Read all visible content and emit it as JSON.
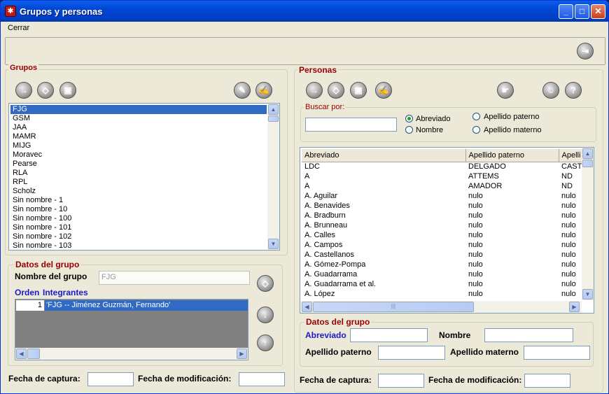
{
  "window": {
    "title": "Grupos y personas"
  },
  "menu": {
    "cerrar": "Cerrar"
  },
  "grupos": {
    "legend": "Grupos",
    "list": [
      "FJG",
      "GSM",
      "JAA",
      "MAMR",
      "MIJG",
      "Moravec",
      "Pearse",
      "RLA",
      "RPL",
      "Scholz",
      "Sin nombre - 1",
      "Sin nombre - 10",
      "Sin nombre - 100",
      "Sin nombre - 101",
      "Sin nombre - 102",
      "Sin nombre - 103"
    ],
    "selected": "FJG"
  },
  "datos_grupo_left": {
    "legend": "Datos del grupo",
    "nombre_label": "Nombre del grupo",
    "nombre_value": "FJG",
    "orden_label": "Orden",
    "integrantes_label": "Integrantes",
    "row_orden": "1",
    "row_integrante": "'FJG -- Jiménez Guzmán, Fernando'"
  },
  "left_footer": {
    "fecha_captura": "Fecha de captura:",
    "fecha_modificacion": "Fecha de modificación:"
  },
  "personas": {
    "legend": "Personas",
    "buscar_label": "Buscar por:",
    "opt_abreviado": "Abreviado",
    "opt_nombre": "Nombre",
    "opt_apellido_paterno": "Apellido paterno",
    "opt_apellido_materno": "Apellido materno",
    "selected_option": "Abreviado"
  },
  "table": {
    "headers": [
      "Abreviado",
      "Apellido paterno",
      "Apelli"
    ],
    "rows": [
      [
        "LDC",
        "DELGADO",
        "CAST"
      ],
      [
        "A",
        "ATTEMS",
        "ND"
      ],
      [
        "A",
        "AMADOR",
        "ND"
      ],
      [
        "A. Aguilar",
        "nulo",
        "nulo"
      ],
      [
        "A. Benavides",
        "nulo",
        "nulo"
      ],
      [
        "A. Bradburn",
        "nulo",
        "nulo"
      ],
      [
        "A. Brunneau",
        "nulo",
        "nulo"
      ],
      [
        "A. Calles",
        "nulo",
        "nulo"
      ],
      [
        "A. Campos",
        "nulo",
        "nulo"
      ],
      [
        "A. Castellanos",
        "nulo",
        "nulo"
      ],
      [
        "A. Gómez-Pompa",
        "nulo",
        "nulo"
      ],
      [
        "A. Guadarrama",
        "nulo",
        "nulo"
      ],
      [
        "A. Guadarrama et al.",
        "nulo",
        "nulo"
      ],
      [
        "A. López",
        "nulo",
        "nulo"
      ]
    ]
  },
  "datos_grupo_right": {
    "legend": "Datos del grupo",
    "abreviado": "Abreviado",
    "nombre": "Nombre",
    "apellido_paterno": "Apellido paterno",
    "apellido_materno": "Apellido materno"
  },
  "right_footer": {
    "fecha_captura": "Fecha de captura:",
    "fecha_modificacion": "Fecha de modificación:"
  },
  "colors": {
    "legend": "#990000",
    "label_blue": "#1a1acc",
    "selection": "#316ac5",
    "titlebar": "#0046d5"
  },
  "icons": [
    "exit-icon",
    "import-icon",
    "eraser-icon",
    "save-icon",
    "pencil-icon",
    "edit-icon",
    "hand-icon",
    "group-icon",
    "group-help-icon",
    "arrow-down-icon",
    "arrow-up-icon"
  ]
}
